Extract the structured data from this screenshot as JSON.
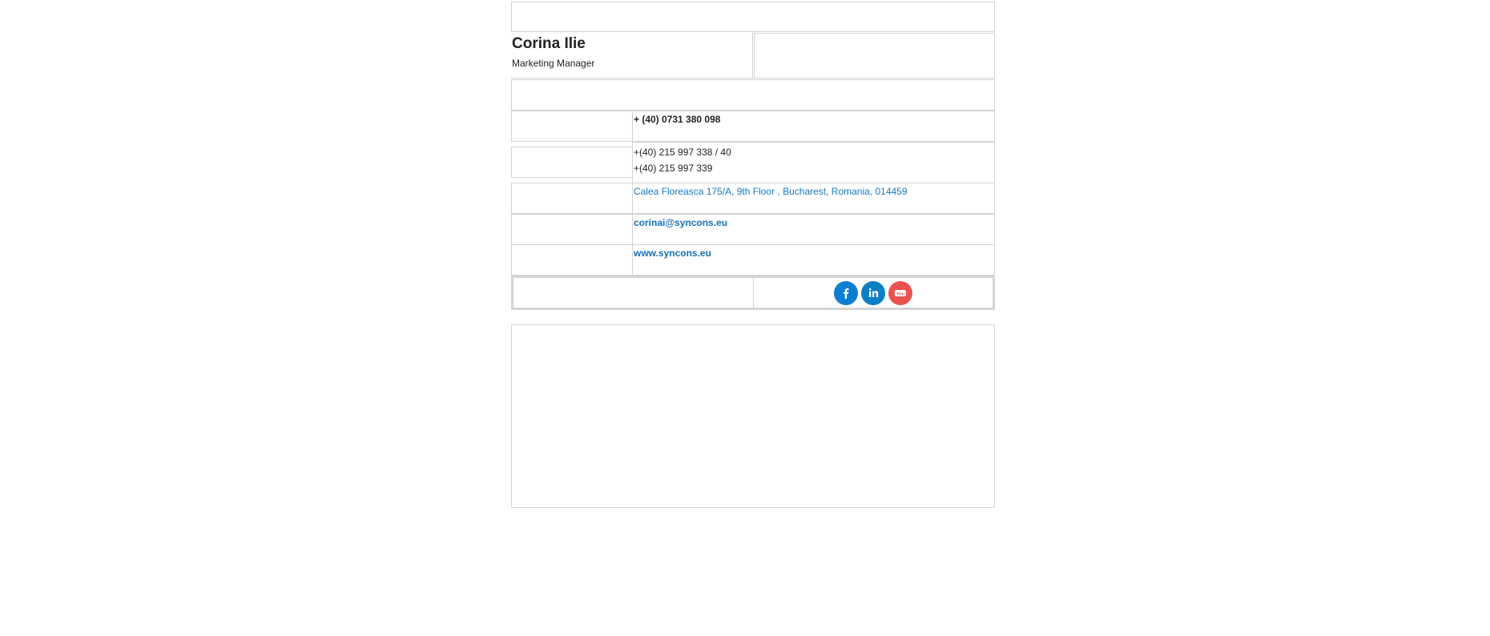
{
  "contact": {
    "name": "Corina Ilie",
    "title": "Marketing Manager",
    "mobile": "+ (40) 0731 380 098",
    "phone_line1": "+(40) 215 997 338 / 40",
    "phone_line2": "+(40) 215 997 339",
    "address": "Calea Floreasca 175/A, 9th Floor ,  Bucharest, Romania, 014459",
    "email": "corinai@syncons.eu",
    "website": "www.syncons.eu"
  },
  "social": [
    {
      "name": "facebook",
      "icon": "facebook-icon",
      "color": "#0d7fd2"
    },
    {
      "name": "linkedin",
      "icon": "linkedin-icon",
      "color": "#0d7fc4"
    },
    {
      "name": "youtube",
      "icon": "youtube-icon",
      "color": "#e8524f"
    }
  ],
  "colors": {
    "link": "#1778c4",
    "border": "#d4d4d4"
  }
}
